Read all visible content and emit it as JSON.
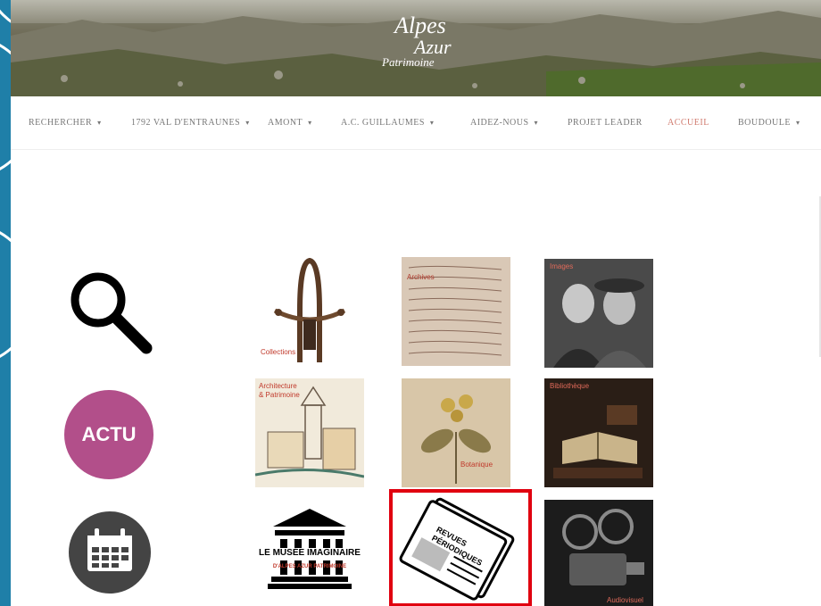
{
  "banner": {
    "logo_line1": "Alpes",
    "logo_line2": "Azur",
    "logo_line3": "Patrimoine"
  },
  "nav": {
    "items": [
      {
        "label": "RECHERCHER",
        "caret": "▾",
        "active": false
      },
      {
        "label": "1792 VAL D'ENTRAUNES",
        "caret": "▾",
        "active": false
      },
      {
        "label": "AMONT",
        "caret": "▾",
        "active": false
      },
      {
        "label": "A.C. GUILLAUMES",
        "caret": "▾",
        "active": false
      },
      {
        "label": "AIDEZ-NOUS",
        "caret": "▾",
        "active": false
      },
      {
        "label": "PROJET LEADER",
        "caret": "",
        "active": false
      },
      {
        "label": "ACCUEIL",
        "caret": "",
        "active": true
      },
      {
        "label": "BOUDOULE",
        "caret": "▾",
        "active": false
      }
    ]
  },
  "tiles": {
    "actu_label": "ACTU",
    "collections_label": "Collections",
    "archives_label": "Archives",
    "images_label": "Images",
    "architecture_label_1": "Architecture",
    "architecture_label_2": "& Patrimoine",
    "botanique_label": "Botanique",
    "bibliotheque_label": "Bibliothèque",
    "musee_line1": "LE MUSÉE IMAGINAIRE",
    "musee_line2": "D'ALPES AZUR PATRIMOINE",
    "revues_line1": "REVUES",
    "revues_line2": "PÉRIODIQUES",
    "audiovisuel_label": "Audiovisuel"
  },
  "colors": {
    "accent": "#d07a6e",
    "actu": "#b24f8a",
    "highlight": "#e0000f",
    "frame": "#1f7fa8"
  },
  "icons": [
    "search-icon",
    "calendar-icon"
  ]
}
